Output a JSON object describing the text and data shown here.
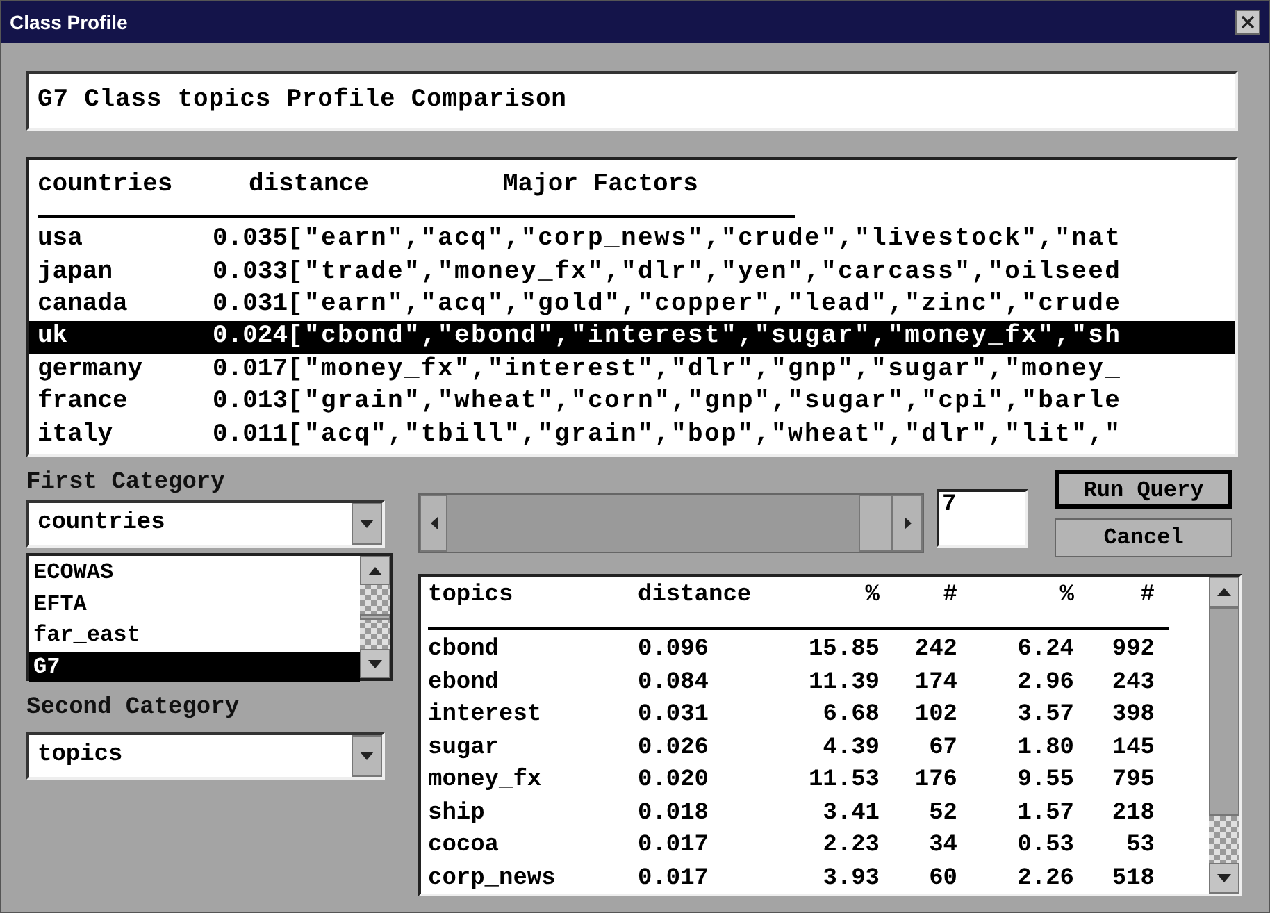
{
  "window": {
    "title": "Class Profile"
  },
  "heading_field": {
    "value": "G7 Class topics Profile Comparison"
  },
  "results": {
    "columns": [
      "countries",
      "distance",
      "Major Factors"
    ],
    "rows": [
      {
        "cells": [
          "usa",
          "0.035",
          "[\"earn\",\"acq\",\"corp_news\",\"crude\",\"livestock\",\"nat"
        ],
        "selected": false
      },
      {
        "cells": [
          "japan",
          "0.033",
          "[\"trade\",\"money_fx\",\"dlr\",\"yen\",\"carcass\",\"oilseed"
        ],
        "selected": false
      },
      {
        "cells": [
          "canada",
          "0.031",
          "[\"earn\",\"acq\",\"gold\",\"copper\",\"lead\",\"zinc\",\"crude"
        ],
        "selected": false
      },
      {
        "cells": [
          "uk",
          "0.024",
          "[\"cbond\",\"ebond\",\"interest\",\"sugar\",\"money_fx\",\"sh"
        ],
        "selected": true
      },
      {
        "cells": [
          "germany",
          "0.017",
          "[\"money_fx\",\"interest\",\"dlr\",\"gnp\",\"sugar\",\"money_"
        ],
        "selected": false
      },
      {
        "cells": [
          "france",
          "0.013",
          "[\"grain\",\"wheat\",\"corn\",\"gnp\",\"sugar\",\"cpi\",\"barle"
        ],
        "selected": false
      },
      {
        "cells": [
          "italy",
          "0.011",
          "[\"acq\",\"tbill\",\"grain\",\"bop\",\"wheat\",\"dlr\",\"lit\",\""
        ],
        "selected": false
      }
    ]
  },
  "first_category": {
    "label": "First Category",
    "value": "countries",
    "items": [
      {
        "label": "ECOWAS",
        "selected": false
      },
      {
        "label": "EFTA",
        "selected": false
      },
      {
        "label": "far_east",
        "selected": false
      },
      {
        "label": "G7",
        "selected": true
      }
    ]
  },
  "second_category": {
    "label": "Second Category",
    "value": "topics"
  },
  "count_field": {
    "value": "7"
  },
  "buttons": [
    {
      "label": "Run Query",
      "default": true
    },
    {
      "label": "Cancel",
      "default": false
    }
  ],
  "topics_table": {
    "columns": [
      "topics",
      "distance",
      "%",
      "#",
      "%",
      "#"
    ],
    "rows": [
      [
        "cbond",
        "0.096",
        "15.85",
        "242",
        "6.24",
        "992"
      ],
      [
        "ebond",
        "0.084",
        "11.39",
        "174",
        "2.96",
        "243"
      ],
      [
        "interest",
        "0.031",
        "6.68",
        "102",
        "3.57",
        "398"
      ],
      [
        "sugar",
        "0.026",
        "4.39",
        "67",
        "1.80",
        "145"
      ],
      [
        "money_fx",
        "0.020",
        "11.53",
        "176",
        "9.55",
        "795"
      ],
      [
        "ship",
        "0.018",
        "3.41",
        "52",
        "1.57",
        "218"
      ],
      [
        "cocoa",
        "0.017",
        "2.23",
        "34",
        "0.53",
        "53"
      ],
      [
        "corp_news",
        "0.017",
        "3.93",
        "60",
        "2.26",
        "518"
      ]
    ]
  }
}
